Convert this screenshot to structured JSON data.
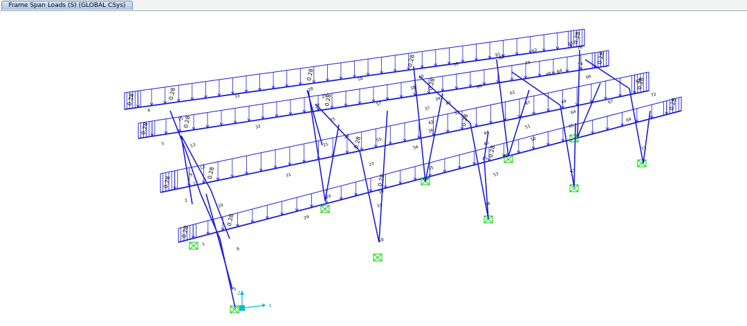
{
  "window": {
    "tab_title": "Frame Span Loads (S) (GLOBAL CSys)"
  },
  "colors": {
    "frame": "#1a1ad6",
    "load": "#1a1ad6",
    "support": "#00d000",
    "axis": "#00bcd4"
  },
  "load_value_label": "0.28",
  "axis_labels": {
    "x": "X",
    "z": "Z"
  },
  "frame_labels": [
    "1",
    "2",
    "3",
    "4",
    "5",
    "6",
    "9",
    "10",
    "12",
    "13",
    "15",
    "17",
    "18",
    "19",
    "20",
    "21",
    "23",
    "24",
    "25",
    "26",
    "27",
    "28",
    "29",
    "30",
    "31",
    "32",
    "33",
    "34",
    "35",
    "36",
    "37",
    "38",
    "39",
    "40",
    "41",
    "42",
    "43",
    "44",
    "45",
    "46",
    "47",
    "48",
    "49",
    "50",
    "51",
    "52",
    "53",
    "54",
    "55",
    "56",
    "57",
    "58",
    "59",
    "60",
    "61",
    "62",
    "63",
    "64",
    "65",
    "66",
    "67",
    "68",
    "69",
    "71",
    "72",
    "74",
    "76",
    "79",
    "81",
    "82",
    "83",
    "84"
  ]
}
